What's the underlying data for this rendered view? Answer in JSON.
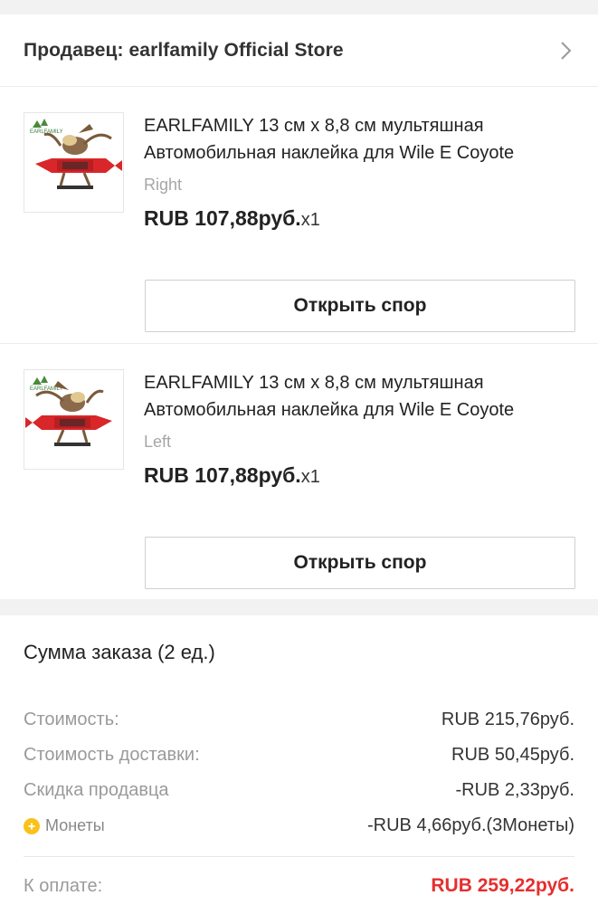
{
  "seller": {
    "text": "Продавец: earlfamily Official Store",
    "chevron_icon": "chevron-right-icon"
  },
  "items": [
    {
      "title": "EARLFAMILY 13 см x 8,8 см мультяшная Автомобильная наклейка для Wile E Coyote",
      "variant": "Right",
      "price": "RUB 107,88руб.",
      "qty": "x1",
      "dispute_label": "Открыть спор",
      "thumb_logo": "EARLFAMILY",
      "thumb_direction": "right"
    },
    {
      "title": "EARLFAMILY 13 см x 8,8 см мультяшная Автомобильная наклейка для Wile E Coyote",
      "variant": "Left",
      "price": "RUB 107,88руб.",
      "qty": "x1",
      "dispute_label": "Открыть спор",
      "thumb_logo": "EARLFAMILY",
      "thumb_direction": "left"
    }
  ],
  "summary": {
    "title": "Сумма заказа (2 ед.)",
    "rows": [
      {
        "label": "Стоимость:",
        "value": "RUB 215,76руб."
      },
      {
        "label": "Стоимость доставки:",
        "value": "RUB 50,45руб."
      },
      {
        "label": "Скидка продавца",
        "value": "-RUB 2,33руб."
      },
      {
        "label": "Монеты",
        "value": "-RUB 4,66руб.(3Монеты)",
        "icon": "coin-icon"
      }
    ],
    "total_label": "К оплате:",
    "total_value": "RUB 259,22руб."
  },
  "colors": {
    "accent_red": "#e62e2e",
    "coin_yellow": "#f9c21a",
    "background": "#f2f2f2"
  }
}
